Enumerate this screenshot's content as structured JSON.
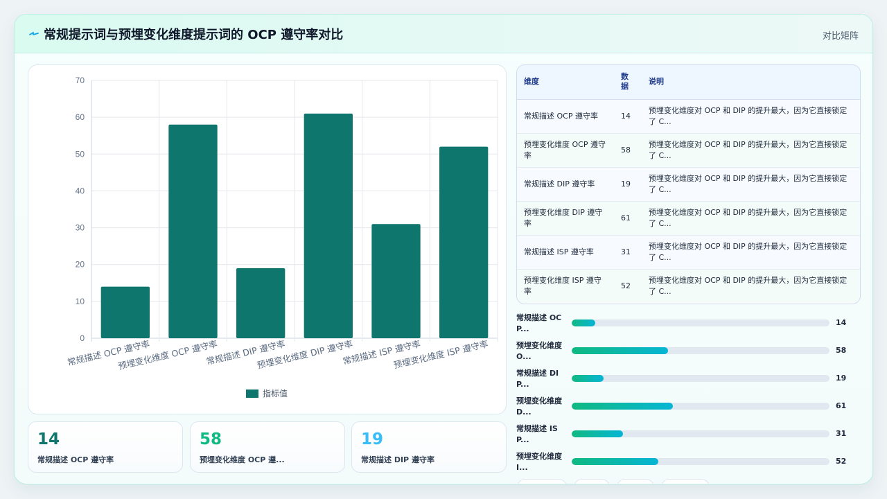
{
  "header": {
    "title": "常规提示词与预埋变化维度提示词的 OCP 遵守率对比",
    "tag": "对比矩阵"
  },
  "colors": {
    "bar": "#0f766e",
    "kpi1": "#0f766e",
    "kpi2": "#10b981",
    "kpi3": "#38bdf8"
  },
  "chart_data": {
    "type": "bar",
    "categories": [
      "常规描述 OCP 遵守率",
      "预埋变化维度 OCP 遵守率",
      "常规描述 DIP 遵守率",
      "预埋变化维度 DIP 遵守率",
      "常规描述 ISP 遵守率",
      "预埋变化维度 ISP 遵守率"
    ],
    "series": [
      {
        "name": "指标值",
        "values": [
          14,
          58,
          19,
          61,
          31,
          52
        ]
      }
    ],
    "ylim": [
      0,
      70
    ],
    "yticks": [
      "0",
      "10",
      "20",
      "30",
      "40",
      "50",
      "60",
      "70"
    ],
    "grid": true,
    "legend": "bottom"
  },
  "kpis": [
    {
      "value": "14",
      "label": "常规描述 OCP 遵守率"
    },
    {
      "value": "58",
      "label": "预埋变化维度 OCP 遵..."
    },
    {
      "value": "19",
      "label": "常规描述 DIP 遵守率"
    }
  ],
  "table": {
    "headers": [
      "维度",
      "数据",
      "说明"
    ],
    "rows": [
      {
        "dim": "常规描述 OCP 遵守率",
        "val": "14",
        "desc": "预埋变化维度对 OCP 和 DIP 的提升最大，因为它直接锁定了 C..."
      },
      {
        "dim": "预埋变化维度 OCP 遵守率",
        "val": "58",
        "desc": "预埋变化维度对 OCP 和 DIP 的提升最大，因为它直接锁定了 C..."
      },
      {
        "dim": "常规描述 DIP 遵守率",
        "val": "19",
        "desc": "预埋变化维度对 OCP 和 DIP 的提升最大，因为它直接锁定了 C..."
      },
      {
        "dim": "预埋变化维度 DIP 遵守率",
        "val": "61",
        "desc": "预埋变化维度对 OCP 和 DIP 的提升最大，因为它直接锁定了 C..."
      },
      {
        "dim": "常规描述 ISP 遵守率",
        "val": "31",
        "desc": "预埋变化维度对 OCP 和 DIP 的提升最大，因为它直接锁定了 C..."
      },
      {
        "dim": "预埋变化维度 ISP 遵守率",
        "val": "52",
        "desc": "预埋变化维度对 OCP 和 DIP 的提升最大，因为它直接锁定了 C..."
      }
    ]
  },
  "progress": [
    {
      "label": "常规描述 OCP...",
      "value": 14,
      "display": "14"
    },
    {
      "label": "预埋变化维度 O...",
      "value": 58,
      "display": "58"
    },
    {
      "label": "常规描述 DIP...",
      "value": 19,
      "display": "19"
    },
    {
      "label": "预埋变化维度 D...",
      "value": 61,
      "display": "61"
    },
    {
      "label": "常规描述 ISP...",
      "value": 31,
      "display": "31"
    },
    {
      "label": "预埋变化维度 I...",
      "value": 52,
      "display": "52"
    }
  ],
  "progress_max": 155
}
